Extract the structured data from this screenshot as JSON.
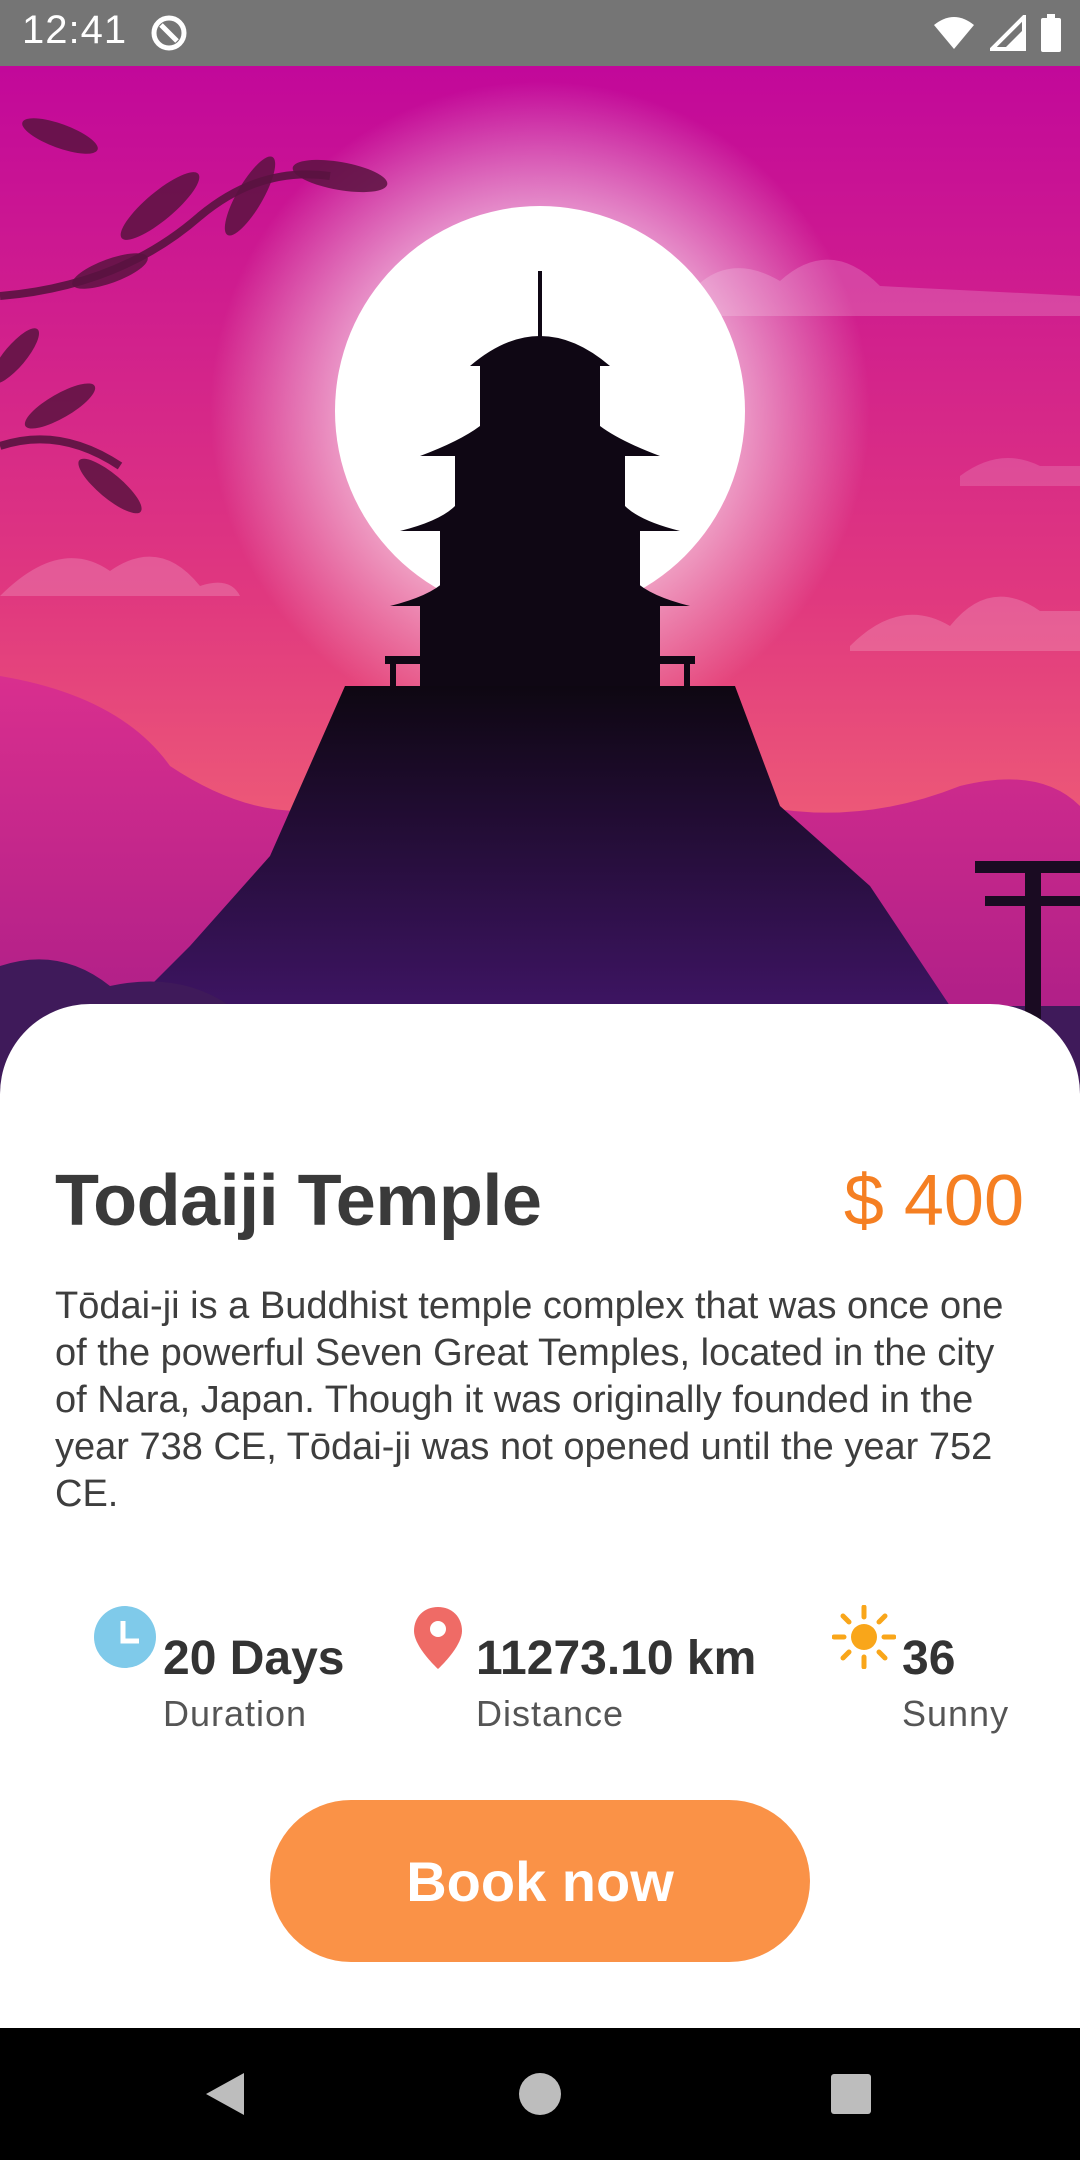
{
  "status_bar": {
    "time": "12:41",
    "icons": [
      "sync-icon",
      "wifi-icon",
      "signal-icon",
      "battery-icon"
    ]
  },
  "hero": {
    "image": "temple-pagoda-sunset-illustration",
    "colors": {
      "sky_top": "#c2089a",
      "sky_bottom": "#e94d79",
      "moon": "#ffffff",
      "silhouette": "#0f0714"
    }
  },
  "destination": {
    "title": "Todaiji Temple",
    "price": "$ 400",
    "description": "Tōdai-ji is a Buddhist temple complex that was once one of the powerful Seven Great Temples, located in the city of Nara, Japan. Though it was originally founded in the year 738 CE, Tōdai-ji was not opened until the year 752 CE."
  },
  "stats": {
    "duration": {
      "icon": "clock-icon",
      "value": "20 Days",
      "label": "Duration"
    },
    "distance": {
      "icon": "location-pin-icon",
      "value": "11273.10 km",
      "label": "Distance"
    },
    "weather": {
      "icon": "sun-icon",
      "value": "36",
      "label": "Sunny"
    }
  },
  "actions": {
    "book_label": "Book now"
  },
  "nav": {
    "icons": [
      "back-icon",
      "home-icon",
      "recents-icon"
    ]
  },
  "colors": {
    "accent": "#fa9247",
    "price": "#f57f22",
    "title": "#3a3a3a"
  }
}
